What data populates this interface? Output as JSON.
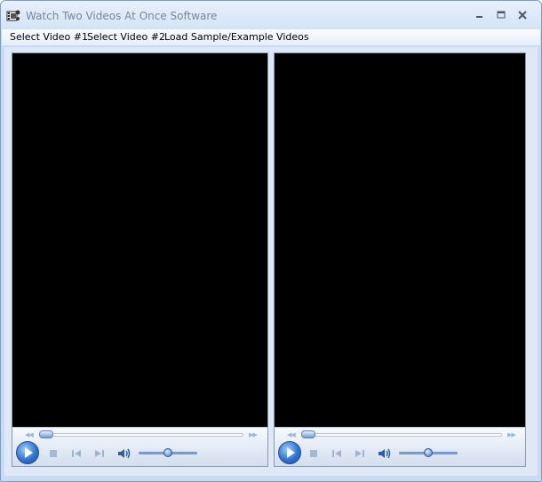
{
  "window": {
    "title": "Watch Two Videos At Once Software",
    "controls": {
      "minimize": "minimize-icon",
      "maximize": "maximize-icon",
      "close": "close-icon"
    }
  },
  "menu": {
    "items": [
      {
        "label": "Select Video #1"
      },
      {
        "label": "Select Video #2"
      },
      {
        "label": "Load Sample/Example Videos"
      }
    ]
  },
  "players": [
    {
      "name": "video-1",
      "seek_position": 0.0,
      "volume": 0.5,
      "state": "stopped"
    },
    {
      "name": "video-2",
      "seek_position": 0.0,
      "volume": 0.5,
      "state": "stopped"
    }
  ],
  "colors": {
    "video_background": "#000000",
    "accent": "#2f74d0",
    "frame": "#c9dbf2"
  }
}
